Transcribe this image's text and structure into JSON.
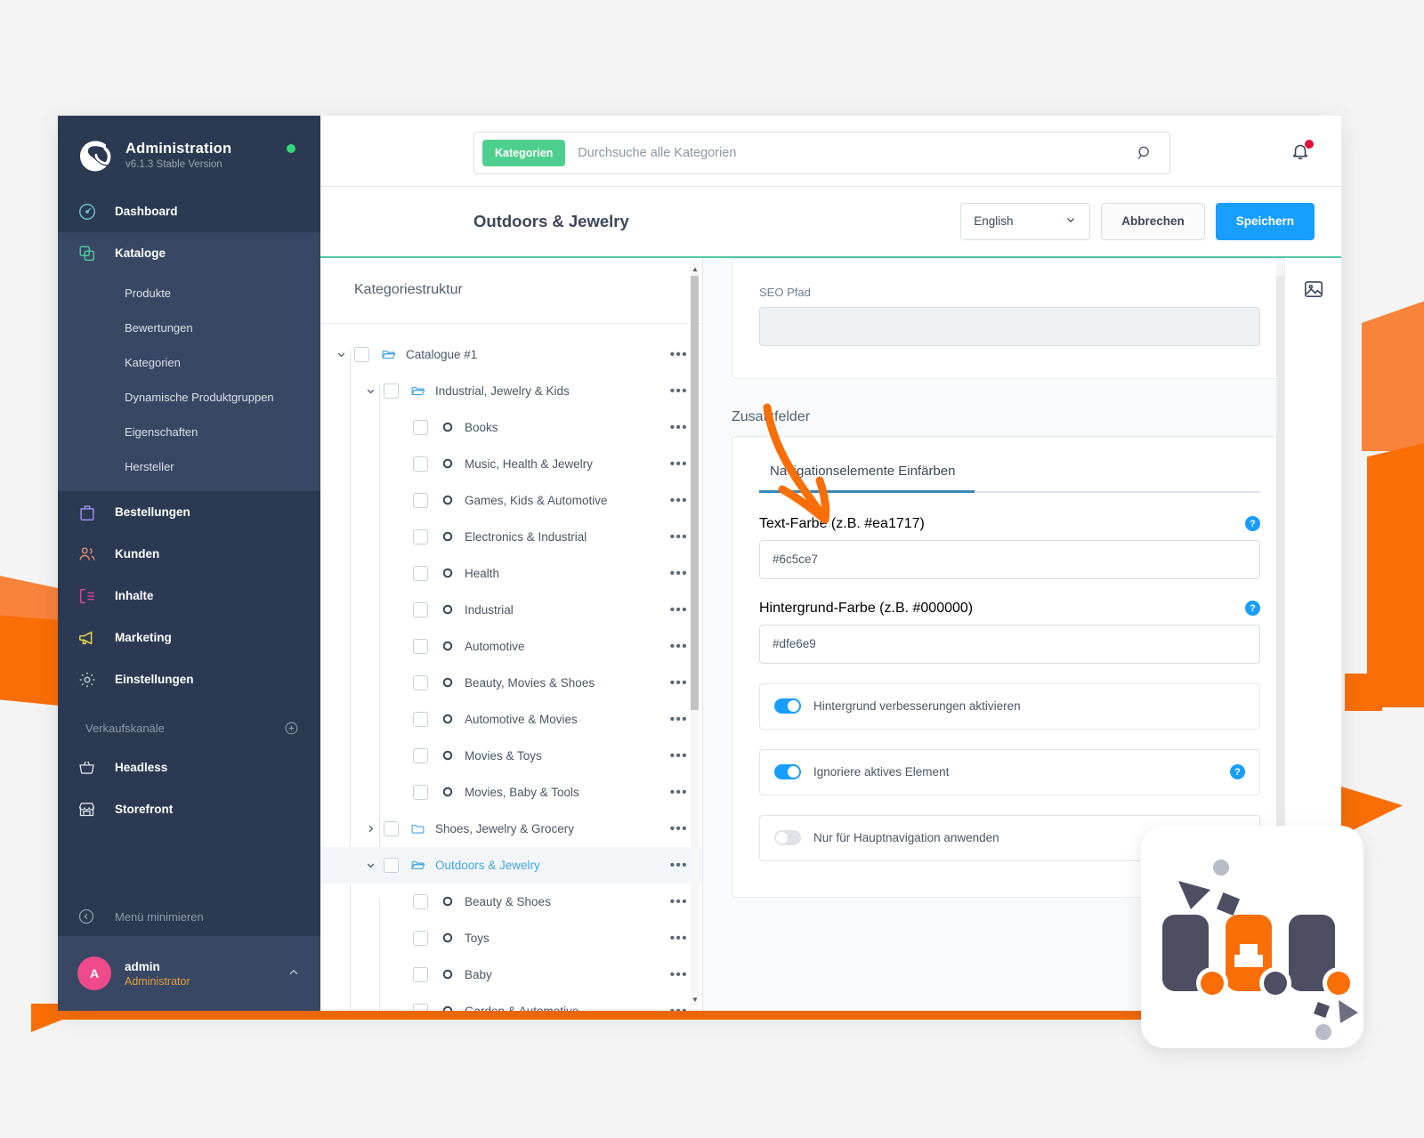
{
  "sidebar": {
    "brand": {
      "title": "Administration",
      "version": "v6.1.3 Stable Version",
      "status_icon": "status-dot-online"
    },
    "items": [
      {
        "label": "Dashboard",
        "icon": "dashboard-icon"
      },
      {
        "label": "Kataloge",
        "icon": "catalogs-icon"
      }
    ],
    "sub_items": [
      {
        "label": "Produkte"
      },
      {
        "label": "Bewertungen"
      },
      {
        "label": "Kategorien"
      },
      {
        "label": "Dynamische Produktgruppen"
      },
      {
        "label": "Eigenschaften"
      },
      {
        "label": "Hersteller"
      }
    ],
    "items2": [
      {
        "label": "Bestellungen",
        "icon": "orders-icon"
      },
      {
        "label": "Kunden",
        "icon": "customers-icon"
      },
      {
        "label": "Inhalte",
        "icon": "content-icon"
      },
      {
        "label": "Marketing",
        "icon": "marketing-icon"
      },
      {
        "label": "Einstellungen",
        "icon": "settings-gear-icon"
      }
    ],
    "sales_channels_label": "Verkaufskanäle",
    "add_channel_icon": "plus-circle-icon",
    "channels": [
      {
        "label": "Headless",
        "icon": "basket-icon"
      },
      {
        "label": "Storefront",
        "icon": "storefront-icon"
      }
    ],
    "minimize_label": "Menü minimieren",
    "minimize_icon": "chevron-left-circle-icon",
    "user": {
      "initial": "A",
      "name": "admin",
      "role": "Administrator",
      "chevron_icon": "chevron-up-icon"
    }
  },
  "topbar": {
    "search_chip": "Kategorien",
    "search_placeholder": "Durchsuche alle Kategorien",
    "search_value": "",
    "search_icon": "search-icon",
    "notifications_icon": "bell-icon"
  },
  "pagebar": {
    "title": "Outdoors & Jewelry",
    "language": "English",
    "language_chevron_icon": "chevron-down-icon",
    "cancel_label": "Abbrechen",
    "save_label": "Speichern"
  },
  "tree": {
    "header": "Kategoriestruktur",
    "row_menu_icon": "more-options-icon",
    "rows": [
      {
        "label": "Catalogue #1",
        "depth": 0,
        "type": "folder-open",
        "caret": "down",
        "selected": false
      },
      {
        "label": "Industrial, Jewelry & Kids",
        "depth": 1,
        "type": "folder-open",
        "caret": "down",
        "selected": false
      },
      {
        "label": "Books",
        "depth": 2,
        "type": "leaf",
        "caret": "",
        "selected": false
      },
      {
        "label": "Music, Health & Jewelry",
        "depth": 2,
        "type": "leaf",
        "caret": "",
        "selected": false
      },
      {
        "label": "Games, Kids & Automotive",
        "depth": 2,
        "type": "leaf",
        "caret": "",
        "selected": false
      },
      {
        "label": "Electronics & Industrial",
        "depth": 2,
        "type": "leaf",
        "caret": "",
        "selected": false
      },
      {
        "label": "Health",
        "depth": 2,
        "type": "leaf",
        "caret": "",
        "selected": false
      },
      {
        "label": "Industrial",
        "depth": 2,
        "type": "leaf",
        "caret": "",
        "selected": false
      },
      {
        "label": "Automotive",
        "depth": 2,
        "type": "leaf",
        "caret": "",
        "selected": false
      },
      {
        "label": "Beauty, Movies & Shoes",
        "depth": 2,
        "type": "leaf",
        "caret": "",
        "selected": false
      },
      {
        "label": "Automotive & Movies",
        "depth": 2,
        "type": "leaf",
        "caret": "",
        "selected": false
      },
      {
        "label": "Movies & Toys",
        "depth": 2,
        "type": "leaf",
        "caret": "",
        "selected": false
      },
      {
        "label": "Movies, Baby & Tools",
        "depth": 2,
        "type": "leaf",
        "caret": "",
        "selected": false
      },
      {
        "label": "Shoes, Jewelry & Grocery",
        "depth": 1,
        "type": "folder-closed",
        "caret": "right",
        "selected": false
      },
      {
        "label": "Outdoors & Jewelry",
        "depth": 1,
        "type": "folder-open",
        "caret": "down",
        "selected": true
      },
      {
        "label": "Beauty & Shoes",
        "depth": 2,
        "type": "leaf",
        "caret": "",
        "selected": false
      },
      {
        "label": "Toys",
        "depth": 2,
        "type": "leaf",
        "caret": "",
        "selected": false
      },
      {
        "label": "Baby",
        "depth": 2,
        "type": "leaf",
        "caret": "",
        "selected": false
      },
      {
        "label": "Garden & Automotive",
        "depth": 2,
        "type": "leaf",
        "caret": "",
        "selected": false
      }
    ]
  },
  "form": {
    "seo_label": "SEO Pfad",
    "seo_value": "",
    "extra_fields_title": "Zusatzfelder",
    "tab_label": "Navigationselemente Einfärben",
    "text_color_label": "Text-Farbe (z.B. #ea1717)",
    "text_color_value": "#6c5ce7",
    "bg_color_label": "Hintergrund-Farbe (z.B. #000000)",
    "bg_color_value": "#dfe6e9",
    "help_icon": "help-question-icon",
    "toggles": [
      {
        "label": "Hintergrund verbesserungen aktivieren",
        "state": "on",
        "has_help": false
      },
      {
        "label": "Ignoriere aktives Element",
        "state": "on",
        "has_help": true
      },
      {
        "label": "Nur für Hauptnavigation anwenden",
        "state": "off",
        "has_help": false
      }
    ],
    "rail_icon": "media-image-icon"
  },
  "annotation": {
    "arrow_icon": "orange-curved-arrow",
    "color": "#f96e06"
  },
  "colors": {
    "sidebar_bg": "#2b3952",
    "accent_green": "#52c6a5",
    "chip_green": "#4fcf8f",
    "primary_blue": "#189eff",
    "orange": "#f96e06",
    "avatar_pink": "#ef4a8b",
    "role_amber": "#e2a03f"
  }
}
